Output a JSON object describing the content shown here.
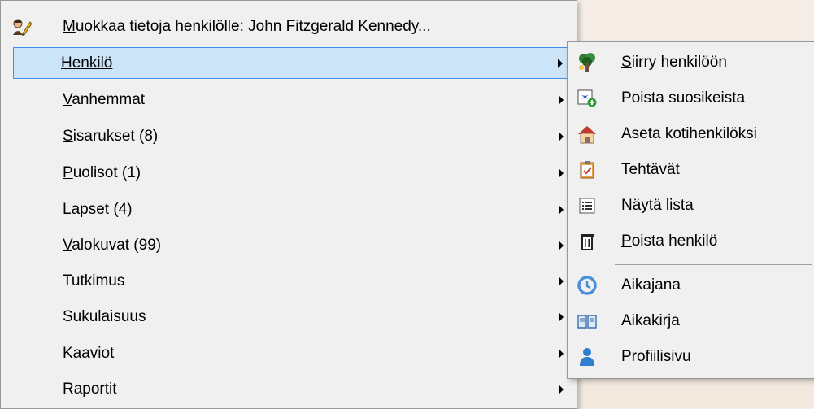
{
  "main_menu": {
    "header": {
      "label": "Muokkaa tietoja henkilölle: John Fitzgerald Kennedy...",
      "icon": "edit-person-icon"
    },
    "items": [
      {
        "label": "Henkilö",
        "accel": "H"
      },
      {
        "label": "Vanhemmat",
        "accel": "V"
      },
      {
        "label": "Sisarukset (8)",
        "accel": "S"
      },
      {
        "label": "Puolisot (1)",
        "accel": "P"
      },
      {
        "label": "Lapset (4)",
        "accel": ""
      },
      {
        "label": "Valokuvat (99)",
        "accel": "V"
      },
      {
        "label": "Tutkimus",
        "accel": ""
      },
      {
        "label": "Sukulaisuus",
        "accel": ""
      },
      {
        "label": "Kaaviot",
        "accel": ""
      },
      {
        "label": "Raportit",
        "accel": ""
      }
    ]
  },
  "submenu": {
    "items": [
      {
        "label": "Siirry henkilöön",
        "icon": "tree-icon"
      },
      {
        "label": "Poista suosikeista",
        "icon": "favorites-remove-icon"
      },
      {
        "label": "Aseta kotihenkilöksi",
        "icon": "home-icon"
      },
      {
        "label": "Tehtävät",
        "icon": "tasks-clipboard-icon"
      },
      {
        "label": "Näytä lista",
        "icon": "list-icon"
      },
      {
        "label": "Poista henkilö",
        "icon": "trash-icon"
      },
      {
        "label": "Aikajana",
        "icon": "timeline-icon"
      },
      {
        "label": "Aikakirja",
        "icon": "book-icon"
      },
      {
        "label": "Profiilisivu",
        "icon": "person-profile-icon"
      }
    ]
  },
  "colors": {
    "highlight_bg": "#cce4f7",
    "highlight_border": "#3f8ee8",
    "menu_bg": "#f0f0f0"
  }
}
